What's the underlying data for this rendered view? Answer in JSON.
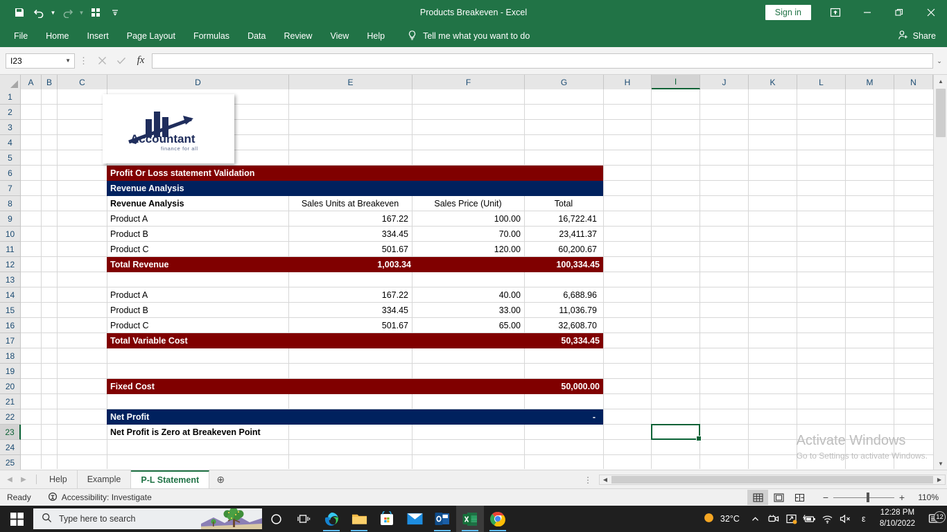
{
  "titlebar": {
    "document_title": "Products Breakeven  -  Excel",
    "signin_label": "Sign in",
    "qat": [
      {
        "name": "save-icon",
        "label": "Save"
      },
      {
        "name": "undo-icon",
        "label": "Undo"
      },
      {
        "name": "redo-icon",
        "label": "Redo"
      },
      {
        "name": "touch-mode-icon",
        "label": "Touch/Mouse Mode"
      },
      {
        "name": "customize-qat-icon",
        "label": "Customize Quick Access Toolbar"
      }
    ],
    "window_buttons": {
      "ribbon_display": "Ribbon Display Options",
      "minimize": "Minimize",
      "restore": "Restore Down",
      "close": "Close"
    }
  },
  "ribbon": {
    "tabs": [
      "File",
      "Home",
      "Insert",
      "Page Layout",
      "Formulas",
      "Data",
      "Review",
      "View",
      "Help"
    ],
    "tellme": "Tell me what you want to do",
    "share": "Share"
  },
  "formulabar": {
    "namebox_value": "I23",
    "formula_value": "",
    "cancel": "Cancel",
    "enter": "Enter",
    "insert_function": "fx"
  },
  "grid": {
    "columns": [
      "A",
      "B",
      "C",
      "D",
      "E",
      "F",
      "G",
      "H",
      "I",
      "J",
      "K",
      "L",
      "M",
      "N"
    ],
    "selected_column": "I",
    "rows": [
      1,
      2,
      3,
      4,
      5,
      6,
      7,
      8,
      9,
      10,
      11,
      12,
      13,
      14,
      15,
      16,
      17,
      18,
      19,
      20,
      21,
      22,
      23,
      24,
      25
    ],
    "selected_row": 23,
    "selected_cell": "I23",
    "logo": {
      "title": "Accountant",
      "subtitle": "finance for all"
    },
    "cells": {
      "title_band": "Profit Or Loss statement Validation",
      "section_band": "Revenue Analysis",
      "header_row": {
        "d": "Revenue Analysis",
        "e": "Sales Units at Breakeven",
        "f": "Sales Price (Unit)",
        "g": "Total"
      },
      "revenue_rows": [
        {
          "label": "Product A",
          "units": "167.22",
          "price": "100.00",
          "total": "16,722.41"
        },
        {
          "label": "Product B",
          "units": "334.45",
          "price": "70.00",
          "total": "23,411.37"
        },
        {
          "label": "Product C",
          "units": "501.67",
          "price": "120.00",
          "total": "60,200.67"
        }
      ],
      "total_revenue": {
        "label": "Total Revenue",
        "units": "1,003.34",
        "total": "100,334.45"
      },
      "variable_rows": [
        {
          "label": "Product A",
          "units": "167.22",
          "price": "40.00",
          "total": "6,688.96"
        },
        {
          "label": "Product B",
          "units": "334.45",
          "price": "33.00",
          "total": "11,036.79"
        },
        {
          "label": "Product C",
          "units": "501.67",
          "price": "65.00",
          "total": "32,608.70"
        }
      ],
      "total_variable_cost": {
        "label": "Total Variable Cost",
        "total": "50,334.45"
      },
      "fixed_cost": {
        "label": "Fixed Cost",
        "total": "50,000.00"
      },
      "net_profit": {
        "label": "Net Profit",
        "total": "-"
      },
      "note": "Net Profit is Zero at Breakeven Point"
    },
    "watermark": {
      "line1": "Activate Windows",
      "line2": "Go to Settings to activate Windows."
    }
  },
  "sheets": {
    "tabs": [
      {
        "label": "Help",
        "active": false
      },
      {
        "label": "Example",
        "active": false
      },
      {
        "label": "P-L Statement",
        "active": true
      }
    ],
    "add_label": "New sheet"
  },
  "statusbar": {
    "mode": "Ready",
    "accessibility": "Accessibility: Investigate",
    "views": [
      "Normal",
      "Page Layout",
      "Page Break Preview"
    ],
    "zoom": "110%"
  },
  "taskbar": {
    "search_placeholder": "Type here to search",
    "apps": [
      {
        "name": "cortana-icon",
        "label": "Cortana"
      },
      {
        "name": "task-view-icon",
        "label": "Task View"
      },
      {
        "name": "edge-icon",
        "label": "Microsoft Edge"
      },
      {
        "name": "file-explorer-icon",
        "label": "File Explorer"
      },
      {
        "name": "microsoft-store-icon",
        "label": "Microsoft Store"
      },
      {
        "name": "mail-icon",
        "label": "Mail"
      },
      {
        "name": "outlook-icon",
        "label": "Outlook"
      },
      {
        "name": "excel-icon",
        "label": "Excel"
      },
      {
        "name": "chrome-icon",
        "label": "Google Chrome"
      }
    ],
    "weather_temp": "32°C",
    "time": "12:28 PM",
    "date": "8/10/2022",
    "notification_count": "12"
  },
  "colors": {
    "excel_green": "#217346",
    "band_maroon": "#800000",
    "band_navy": "#00215e",
    "selection_green": "#0b6236"
  }
}
